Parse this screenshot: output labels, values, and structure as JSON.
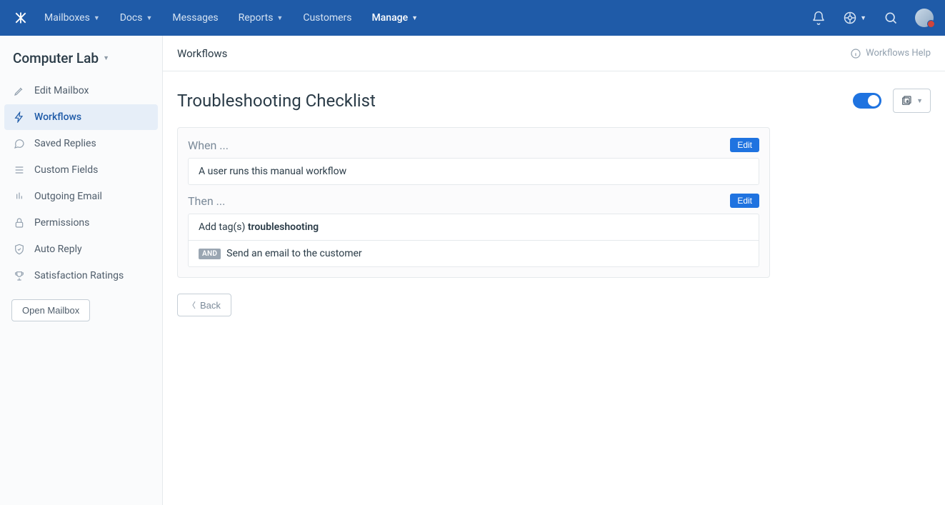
{
  "topnav": {
    "items": [
      {
        "label": "Mailboxes",
        "dropdown": true
      },
      {
        "label": "Docs",
        "dropdown": true
      },
      {
        "label": "Messages",
        "dropdown": false
      },
      {
        "label": "Reports",
        "dropdown": true
      },
      {
        "label": "Customers",
        "dropdown": false
      },
      {
        "label": "Manage",
        "dropdown": true,
        "active": true
      }
    ]
  },
  "sidebar": {
    "mailbox_name": "Computer Lab",
    "items": [
      {
        "label": "Edit Mailbox"
      },
      {
        "label": "Workflows",
        "active": true
      },
      {
        "label": "Saved Replies"
      },
      {
        "label": "Custom Fields"
      },
      {
        "label": "Outgoing Email"
      },
      {
        "label": "Permissions"
      },
      {
        "label": "Auto Reply"
      },
      {
        "label": "Satisfaction Ratings"
      }
    ],
    "open_mailbox_label": "Open Mailbox"
  },
  "subheader": {
    "crumb": "Workflows",
    "help_label": "Workflows Help"
  },
  "workflow": {
    "title": "Troubleshooting Checklist",
    "when_label": "When ...",
    "when_edit": "Edit",
    "when_condition": "A user runs this manual workflow",
    "then_label": "Then ...",
    "then_edit": "Edit",
    "then_action_prefix": "Add tag(s) ",
    "then_action_tag": "troubleshooting",
    "and_badge": "AND",
    "then_action2": "Send an email to the customer",
    "back_label": "Back"
  }
}
